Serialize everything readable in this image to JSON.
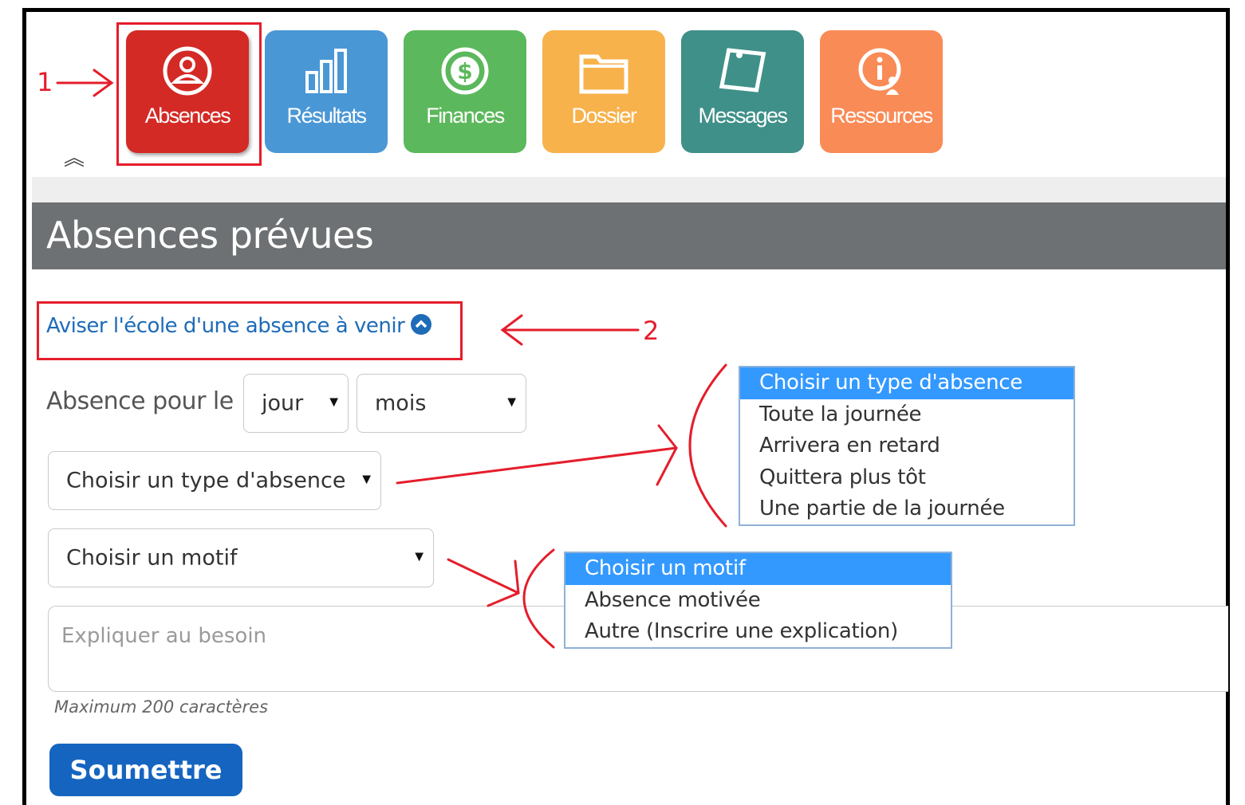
{
  "nav": {
    "tiles": [
      {
        "label": "Absences",
        "icon": "person-circle-icon",
        "color": "#d42a25"
      },
      {
        "label": "Résultats",
        "icon": "bar-chart-icon",
        "color": "#4a97d6"
      },
      {
        "label": "Finances",
        "icon": "dollar-coin-icon",
        "color": "#5cb85c"
      },
      {
        "label": "Dossier",
        "icon": "folder-icon",
        "color": "#f7b24c"
      },
      {
        "label": "Messages",
        "icon": "note-icon",
        "color": "#3f9089"
      },
      {
        "label": "Ressources",
        "icon": "info-person-icon",
        "color": "#f98b57"
      }
    ],
    "collapse_glyph": "︽"
  },
  "page": {
    "title": "Absences prévues"
  },
  "notify_link": {
    "label": "Aviser l'école d'une absence à venir"
  },
  "form": {
    "absence_for_label": "Absence pour le",
    "day_select": {
      "value": "jour"
    },
    "month_select": {
      "value": "mois"
    },
    "type_select": {
      "value": "Choisir un type d'absence"
    },
    "reason_select": {
      "value": "Choisir un motif"
    },
    "explain": {
      "placeholder": "Expliquer au besoin"
    },
    "max_hint": "Maximum 200 caractères",
    "submit_label": "Soumettre"
  },
  "type_dropdown": {
    "options": [
      "Choisir un type d'absence",
      "Toute la journée",
      "Arrivera en retard",
      "Quittera plus tôt",
      "Une partie de la journée"
    ],
    "selected_index": 0
  },
  "reason_dropdown": {
    "options": [
      "Choisir un motif",
      "Absence motivée",
      "Autre (Inscrire une explication)"
    ],
    "selected_index": 0
  },
  "annotations": {
    "marker_1": "1",
    "marker_2": "2",
    "color": "#e51d2b"
  }
}
